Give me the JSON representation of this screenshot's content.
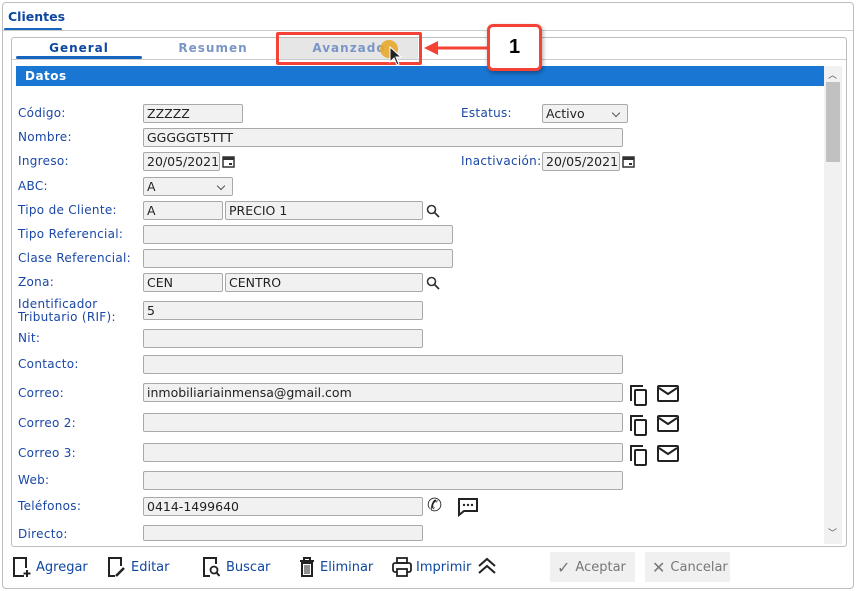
{
  "window_tab": "Clientes",
  "subtabs": [
    "General",
    "Resumen",
    "Avanzado"
  ],
  "section_title": "Datos",
  "fields": {
    "codigo": {
      "label": "Código:",
      "value": "ZZZZZ"
    },
    "estatus": {
      "label": "Estatus:",
      "value": "Activo"
    },
    "nombre": {
      "label": "Nombre:",
      "value": "GGGGGT5TTT"
    },
    "ingreso": {
      "label": "Ingreso:",
      "value": "20/05/2021"
    },
    "inactivacion": {
      "label": "Inactivación:",
      "value": "20/05/2021"
    },
    "abc": {
      "label": "ABC:",
      "value": "A"
    },
    "tipo_cliente": {
      "label": "Tipo de Cliente:",
      "code": "A",
      "desc": "PRECIO 1"
    },
    "tipo_referencial": {
      "label": "Tipo Referencial:",
      "value": ""
    },
    "clase_referencial": {
      "label": "Clase Referencial:",
      "value": ""
    },
    "zona": {
      "label": "Zona:",
      "code": "CEN",
      "desc": "CENTRO"
    },
    "rif": {
      "label": "Identificador Tributario (RIF):",
      "value": "5"
    },
    "nit": {
      "label": "Nit:",
      "value": ""
    },
    "contacto": {
      "label": "Contacto:",
      "value": ""
    },
    "correo": {
      "label": "Correo:",
      "value": "inmobiliariainmensa@gmail.com"
    },
    "correo2": {
      "label": "Correo 2:",
      "value": ""
    },
    "correo3": {
      "label": "Correo 3:",
      "value": ""
    },
    "web": {
      "label": "Web:",
      "value": ""
    },
    "telefonos": {
      "label": "Teléfonos:",
      "value": "0414-1499640"
    },
    "directo": {
      "label": "Directo:",
      "value": ""
    }
  },
  "toolbar": {
    "agregar": "Agregar",
    "editar": "Editar",
    "buscar": "Buscar",
    "eliminar": "Eliminar",
    "imprimir": "Imprimir",
    "aceptar": "Aceptar",
    "cancelar": "Cancelar"
  },
  "annotation": {
    "number": "1"
  },
  "colors": {
    "accent": "#1976d2",
    "label": "#1a47a6",
    "annotation": "#f44336"
  }
}
